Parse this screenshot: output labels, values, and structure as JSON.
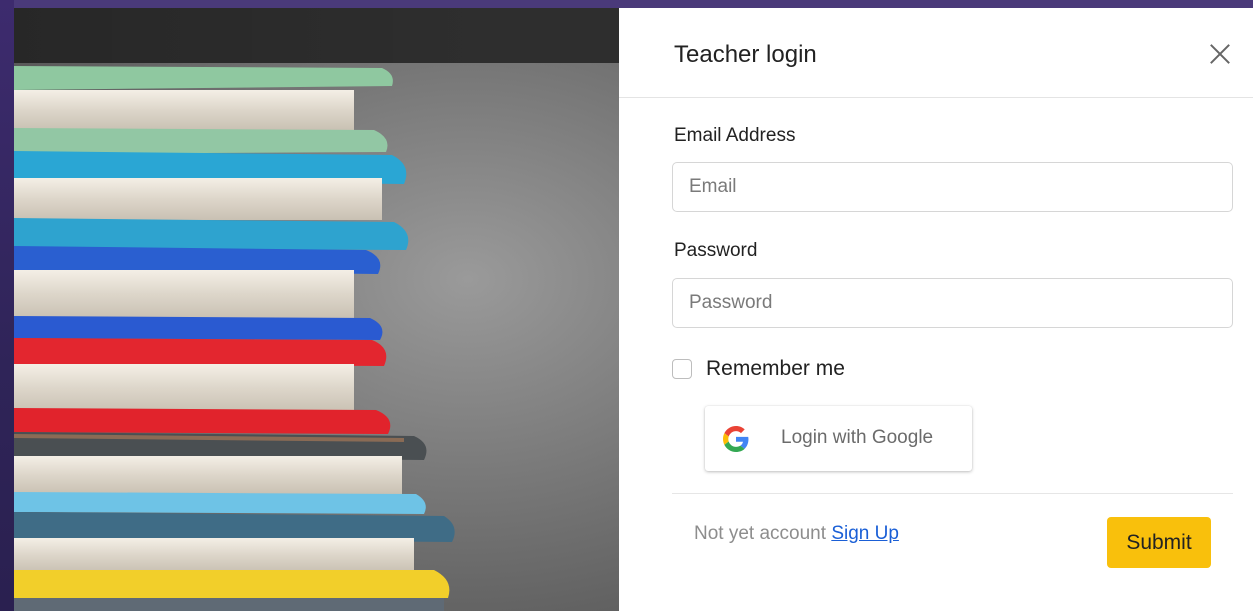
{
  "modal": {
    "title": "Teacher login",
    "close_icon": "close-icon"
  },
  "form": {
    "email_label": "Email Address",
    "email_placeholder": "Email",
    "email_value": "",
    "password_label": "Password",
    "password_placeholder": "Password",
    "password_value": "",
    "remember_label": "Remember me",
    "remember_checked": false
  },
  "google_button": {
    "label": "Login with Google",
    "icon": "google-logo-icon"
  },
  "footer": {
    "prompt": "Not yet account",
    "signup_link": "Sign Up",
    "submit_label": "Submit"
  },
  "colors": {
    "submit_bg": "#f9c00c",
    "link": "#1a5fd6",
    "backdrop": "#3b2a6b"
  }
}
